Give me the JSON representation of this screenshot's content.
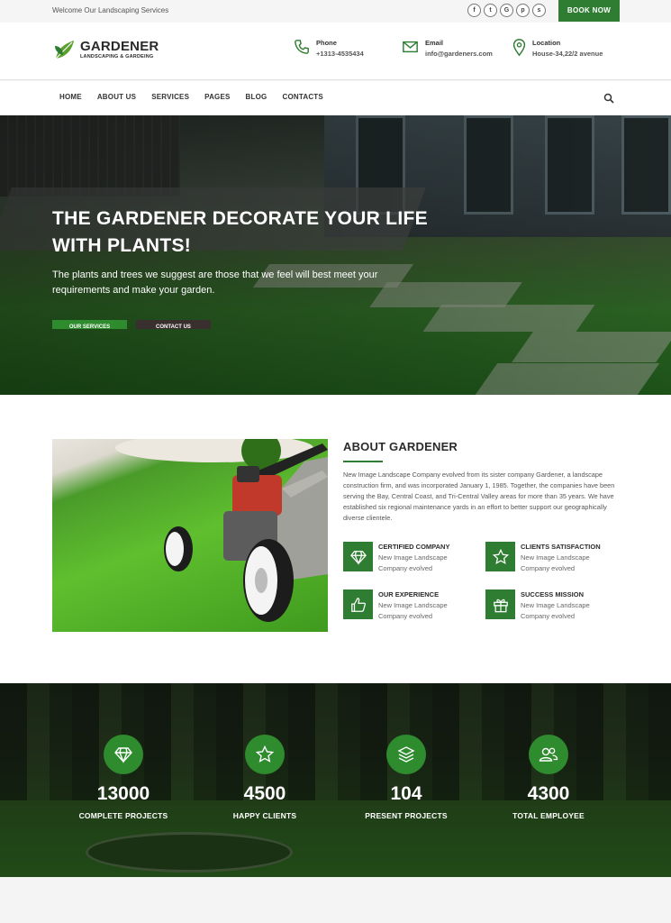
{
  "topbar": {
    "welcome": "Welcome Our Landscaping Services",
    "socials": [
      {
        "icon": "facebook-icon",
        "glyph": "f"
      },
      {
        "icon": "twitter-icon",
        "glyph": "t"
      },
      {
        "icon": "google-icon",
        "glyph": "G"
      },
      {
        "icon": "pinterest-icon",
        "glyph": "p"
      },
      {
        "icon": "skype-icon",
        "glyph": "s"
      }
    ],
    "book_label": "BOOK NOW"
  },
  "header": {
    "logo_name": "GARDENER",
    "logo_tag": "LANDSCAPING & GARDEING",
    "phone_label": "Phone",
    "phone_value": "+1313-4535434",
    "email_label": "Email",
    "email_value": "info@gardeners.com",
    "location_label": "Location",
    "location_value": "House-34,22/2 avenue"
  },
  "nav": {
    "items": [
      "HOME",
      "ABOUT US",
      "SERVICES",
      "PAGES",
      "BLOG",
      "CONTACTS"
    ]
  },
  "hero": {
    "title": "THE GARDENER DECORATE YOUR LIFE WITH PLANTS!",
    "subtitle": "The plants and trees we suggest are those that we feel will best meet your requirements and make your garden.",
    "btn_primary": "OUR SERVICES",
    "btn_secondary": "CONTACT US"
  },
  "about": {
    "title": "ABOUT GARDENER",
    "description": "New Image Landscape Company evolved from its sister company Gardener, a landscape construction firm, and was incorporated January 1, 1985. Together, the companies have been serving the Bay, Central Coast, and Tri-Central Valley areas for more than 35 years. We have established six regional maintenance yards in an effort to better support our geographically diverse clientele.",
    "features": [
      {
        "title": "CERTIFIED COMPANY",
        "desc": "New Image Landscape Company evolved",
        "icon": "diamond-icon"
      },
      {
        "title": "CLIENTS SATISFACTION",
        "desc": "New Image Landscape Company evolved",
        "icon": "star-icon"
      },
      {
        "title": "OUR EXPERIENCE",
        "desc": "New Image Landscape Company evolved",
        "icon": "thumbs-up-icon"
      },
      {
        "title": "SUCCESS MISSION",
        "desc": "New Image Landscape Company evolved",
        "icon": "gift-icon"
      }
    ]
  },
  "stats": [
    {
      "value": "13000",
      "label": "COMPLETE PROJECTS",
      "icon": "diamond-icon"
    },
    {
      "value": "4500",
      "label": "HAPPY CLIENTS",
      "icon": "star-icon"
    },
    {
      "value": "104",
      "label": "PRESENT PROJECTS",
      "icon": "layers-icon"
    },
    {
      "value": "4300",
      "label": "TOTAL EMPLOYEE",
      "icon": "users-icon"
    }
  ],
  "colors": {
    "brand_green": "#2e7d32",
    "dark_text": "#2b2b2b"
  }
}
